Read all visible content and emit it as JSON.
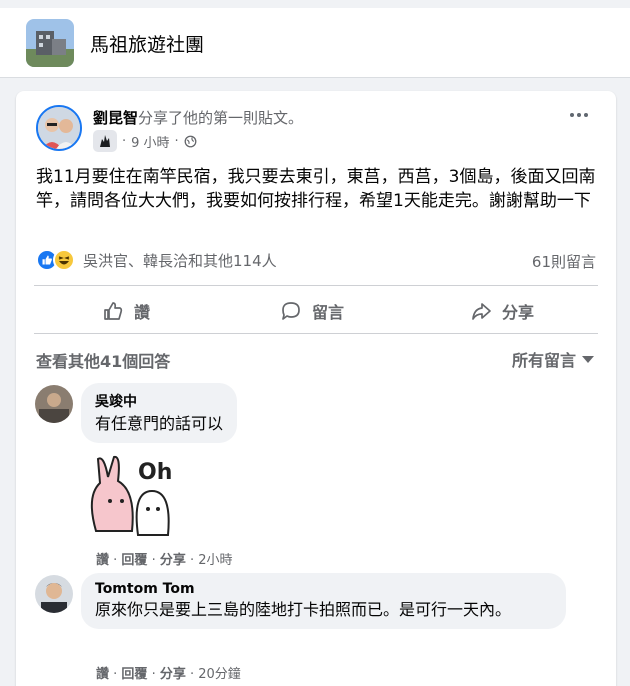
{
  "group": {
    "name": "馬祖旅遊社團"
  },
  "post": {
    "author": "劉昆智",
    "action_text": "分享了他的第一則貼文。",
    "time": "9 小時",
    "separator": "·",
    "text": "我11月要住在南竿民宿，我只要去東引，東莒，西莒，3個島，後面又回南竿，請問各位大大們，我要如何按排行程，希望1天能走完。謝謝幫助一下",
    "reaction_names": "吳洪官、韓長洽和其他114人",
    "comment_count": "61則留言"
  },
  "actions": {
    "like": "讚",
    "comment": "留言",
    "share": "分享"
  },
  "comments_header": {
    "view_more": "查看其他41個回答",
    "sort": "所有留言"
  },
  "comments": [
    {
      "name": "吳竣中",
      "text": "有任意門的話可以",
      "like": "讚",
      "reply": "回覆",
      "share": "分享",
      "time": "2小時",
      "sticker_text": "Oh"
    },
    {
      "name": "Tomtom Tom",
      "text": "原來你只是要上三島的陸地打卡拍照而已。是可行一天內。",
      "like": "讚",
      "reply": "回覆",
      "share": "分享",
      "time": "20分鐘"
    }
  ],
  "colors": {
    "accent": "#1877f2",
    "background": "#f0f2f5",
    "secondary_text": "#65676b"
  },
  "icons": [
    "earth-icon",
    "more-icon",
    "like-icon",
    "comment-icon",
    "share-icon",
    "caret-down-icon",
    "like-reaction-icon",
    "haha-reaction-icon",
    "rising-star-badge-icon"
  ]
}
